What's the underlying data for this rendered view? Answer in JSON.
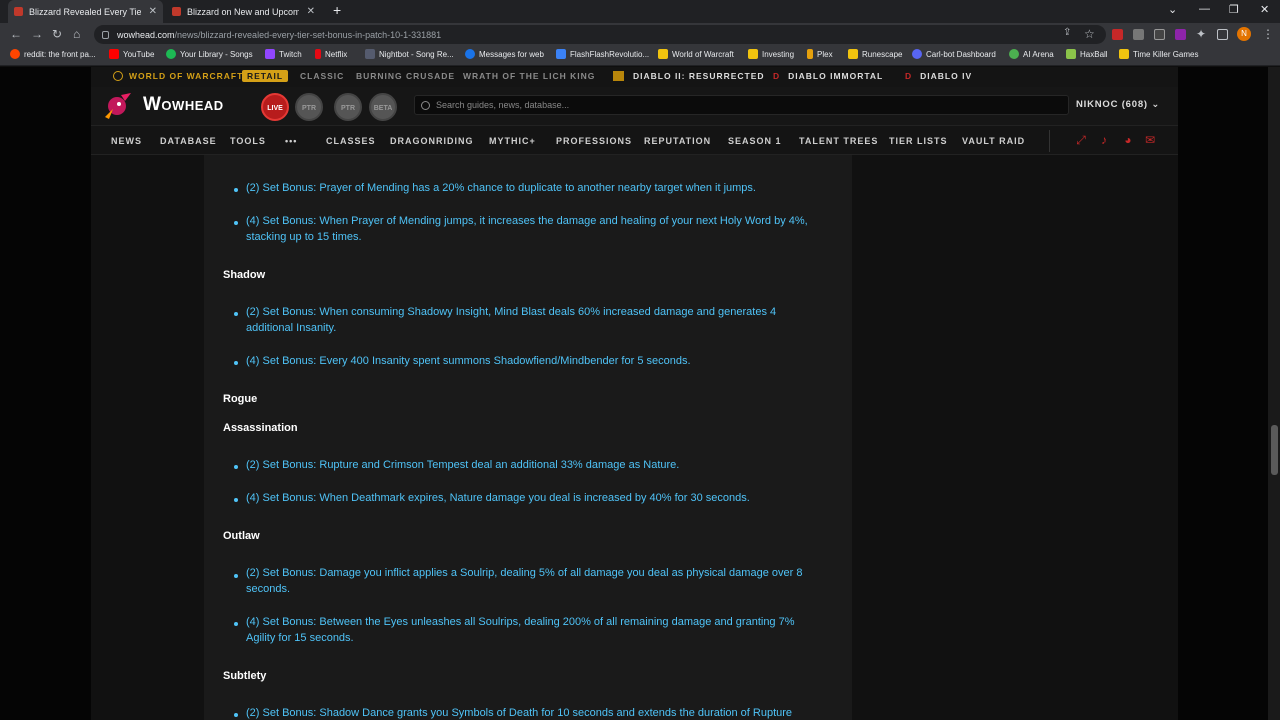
{
  "browser": {
    "tabs": [
      {
        "title": "Blizzard Revealed Every Tier Set B",
        "active": true
      },
      {
        "title": "Blizzard on New and Upcoming",
        "active": false
      }
    ],
    "new_tab": "+",
    "url_host": "wowhead.com",
    "url_path": "/news/blizzard-revealed-every-tier-set-bonus-in-patch-10-1-331881",
    "profile_initial": "N",
    "bookmarks": [
      {
        "label": "reddit: the front pa...",
        "color": "#ff4500"
      },
      {
        "label": "YouTube",
        "color": "#ff0000"
      },
      {
        "label": "Your Library - Songs",
        "color": "#1db954"
      },
      {
        "label": "Twitch",
        "color": "#9146ff"
      },
      {
        "label": "Netflix",
        "color": "#e50914"
      },
      {
        "label": "Nightbot - Song Re...",
        "color": "#555b6e"
      },
      {
        "label": "Messages for web",
        "color": "#1a73e8"
      },
      {
        "label": "FlashFlashRevolutio...",
        "color": "#3b82f6"
      },
      {
        "label": "World of Warcraft",
        "color": "#f1c40f"
      },
      {
        "label": "Investing",
        "color": "#f1c40f"
      },
      {
        "label": "Plex",
        "color": "#e5a00d"
      },
      {
        "label": "Runescape",
        "color": "#f1c40f"
      },
      {
        "label": "Carl-bot Dashboard",
        "color": "#5865f2"
      },
      {
        "label": "AI Arena",
        "color": "#4caf50"
      },
      {
        "label": "HaxBall",
        "color": "#8bc34a"
      },
      {
        "label": "Time Killer Games",
        "color": "#f1c40f"
      }
    ]
  },
  "site": {
    "games": {
      "wow": "WORLD OF WARCRAFT",
      "retail": "RETAIL",
      "classic": "CLASSIC",
      "bc": "BURNING CRUSADE",
      "wotlk": "WRATH OF THE LICH KING",
      "d2": "DIABLO II: RESURRECTED",
      "di": "DIABLO IMMORTAL",
      "d4": "DIABLO IV"
    },
    "logo": "Wowhead",
    "pills": {
      "live": "LIVE",
      "ptr1": "PTR",
      "ptr2": "PTR",
      "beta": "BETA"
    },
    "search_placeholder": "Search guides, news, database...",
    "user": "NIKNOC (608)",
    "nav": {
      "news": "NEWS",
      "database": "DATABASE",
      "tools": "TOOLS",
      "more": "•••",
      "classes": "CLASSES",
      "dragonriding": "DRAGONRIDING",
      "mythic": "MYTHIC+",
      "professions": "PROFESSIONS",
      "reputation": "REPUTATION",
      "season": "SEASON 1",
      "talents": "TALENT TREES",
      "tier": "TIER LISTS",
      "vault": "VAULT RAID"
    }
  },
  "article": {
    "holy_2": "(2) Set Bonus: Prayer of Mending has a 20% chance to duplicate to another nearby target when it jumps.",
    "holy_4": "(4) Set Bonus: When Prayer of Mending jumps, it increases the damage and healing of your next Holy Word by 4%, stacking up to 15 times.",
    "shadow_h": "Shadow",
    "shadow_2": "(2) Set Bonus: When consuming Shadowy Insight, Mind Blast deals 60% increased damage and generates 4 additional Insanity.",
    "shadow_4": "(4) Set Bonus: Every 400 Insanity spent summons Shadowfiend/Mindbender for 5 seconds.",
    "rogue_h": "Rogue",
    "assassination_h": "Assassination",
    "assassination_2": "(2) Set Bonus: Rupture and Crimson Tempest deal an additional 33% damage as Nature.",
    "assassination_4": "(4) Set Bonus: When Deathmark expires, Nature damage you deal is increased by 40% for 30 seconds.",
    "outlaw_h": "Outlaw",
    "outlaw_2": "(2) Set Bonus: Damage you inflict applies a Soulrip, dealing 5% of all damage you deal as physical damage over 8 seconds.",
    "outlaw_4": "(4) Set Bonus: Between the Eyes unleashes all Soulrips, dealing 200% of all remaining damage and granting 7% Agility for 15 seconds.",
    "subtlety_h": "Subtlety",
    "subtlety_2": "(2) Set Bonus: Shadow Dance grants you Symbols of Death for 10 seconds and extends the duration of Rupture"
  }
}
